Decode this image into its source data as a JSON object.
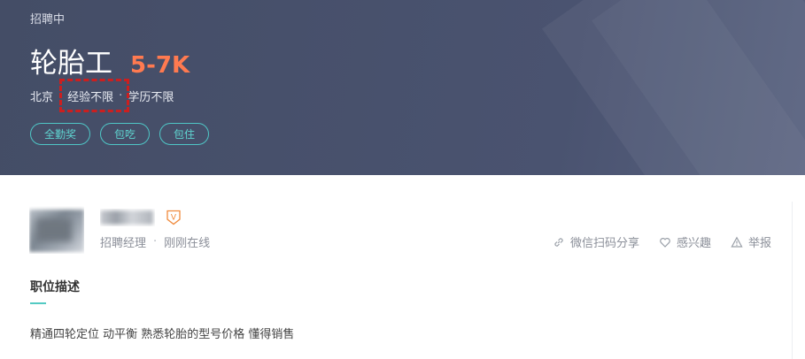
{
  "job": {
    "status": "招聘中",
    "title": "轮胎工",
    "salary": "5-7K",
    "city": "北京",
    "experience": "经验不限",
    "education": "学历不限",
    "separator": "·",
    "tags": [
      "全勤奖",
      "包吃",
      "包住"
    ]
  },
  "recruiter": {
    "role": "招聘经理",
    "separator": "·",
    "online_status": "刚刚在线",
    "badge_letter": "V"
  },
  "actions": {
    "share": "微信扫码分享",
    "interest": "感兴趣",
    "report": "举报"
  },
  "description": {
    "section_title": "职位描述",
    "text": "精通四轮定位 动平衡 熟悉轮胎的型号价格 懂得销售"
  },
  "colors": {
    "header_bg": "#4a5370",
    "salary": "#ff7a50",
    "tag_teal": "#4fc6c6",
    "accent_underline": "#53cac3",
    "highlight_box": "#cc1f1f"
  },
  "icons": {
    "share": "link-icon",
    "interest": "heart-icon",
    "report": "warning-icon",
    "badge": "verified-shield-icon"
  }
}
